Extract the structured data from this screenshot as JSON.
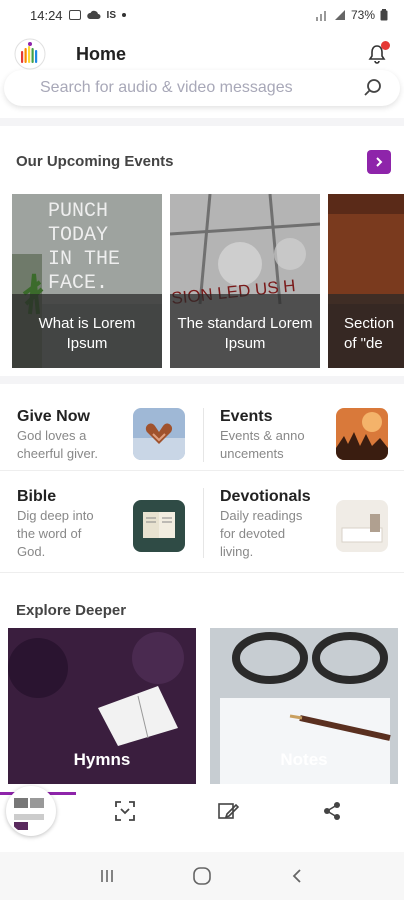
{
  "status_bar": {
    "time": "14:24",
    "extra": "IS",
    "battery": "73%"
  },
  "header": {
    "title": "Home",
    "logo_icon": "rainbow-bars-logo",
    "notification_icon": "bell-icon",
    "badge_color": "#e53935"
  },
  "search": {
    "placeholder": "Search for audio & video messages"
  },
  "events_section": {
    "title": "Our Upcoming Events",
    "arrow_color": "#8e24aa",
    "cards": [
      {
        "caption": "What is Lorem Ipsum",
        "image_text": "PUNCH TODAY IN THE FACE."
      },
      {
        "caption": "The standard Lorem Ipsum",
        "image_text": "SION LED US H"
      },
      {
        "caption": "Section of \"de"
      }
    ]
  },
  "tiles": [
    {
      "title": "Give Now",
      "subtitle_lines": [
        "God loves a",
        "cheerful giver."
      ],
      "thumb_icon": "hands-heart-icon"
    },
    {
      "title": "Events",
      "subtitle_lines": [
        "Events & anno",
        "uncements"
      ],
      "thumb_icon": "concert-crowd-icon"
    },
    {
      "title": "Bible",
      "subtitle_lines": [
        "Dig deep into",
        "the word of",
        "God."
      ],
      "thumb_icon": "open-bible-icon"
    },
    {
      "title": "Devotionals",
      "subtitle_lines": [
        "Daily readings",
        "for devoted",
        "living."
      ],
      "thumb_icon": "book-desk-icon"
    }
  ],
  "explore_section": {
    "title": "Explore Deeper",
    "cards": [
      {
        "label": "Hymns"
      },
      {
        "label": "Notes"
      }
    ]
  },
  "toolbar": {
    "icons": [
      "screenshot-thumbnail",
      "scan-icon",
      "edit-icon",
      "share-icon"
    ]
  },
  "nav_bar": {
    "icons": [
      "recents-icon",
      "home-icon",
      "back-icon"
    ]
  },
  "accent_color": "#8e24aa"
}
